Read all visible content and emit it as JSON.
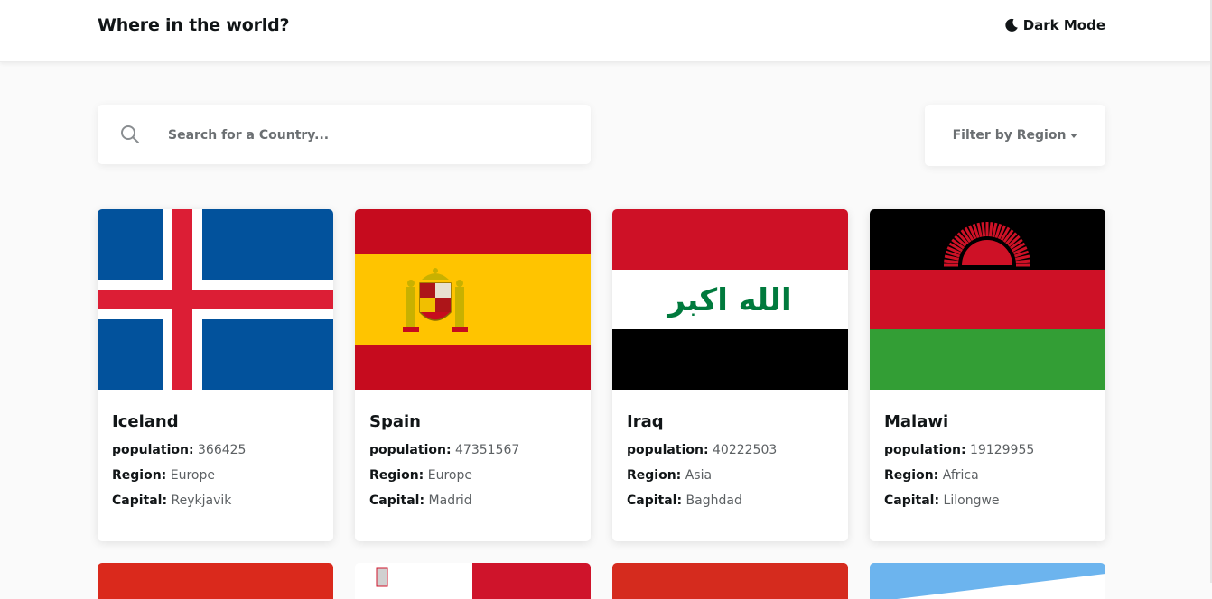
{
  "header": {
    "title": "Where in the world?",
    "dark_mode_label": "Dark Mode",
    "dark_mode_icon": "moon-icon"
  },
  "search": {
    "placeholder": "Search for a Country...",
    "value": "",
    "icon": "search-icon"
  },
  "filter": {
    "label": "Filter by Region",
    "icon": "caret-down-icon"
  },
  "labels": {
    "population": "population:",
    "region": "Region:",
    "capital": "Capital:"
  },
  "countries": [
    {
      "name": "Iceland",
      "population": "366425",
      "region": "Europe",
      "capital": "Reykjavik",
      "flag": "iceland-flag"
    },
    {
      "name": "Spain",
      "population": "47351567",
      "region": "Europe",
      "capital": "Madrid",
      "flag": "spain-flag"
    },
    {
      "name": "Iraq",
      "population": "40222503",
      "region": "Asia",
      "capital": "Baghdad",
      "flag": "iraq-flag",
      "flag_text": "الله اكبر"
    },
    {
      "name": "Malawi",
      "population": "19129955",
      "region": "Africa",
      "capital": "Lilongwe",
      "flag": "malawi-flag"
    }
  ],
  "colors": {
    "background": "#fafafa",
    "card": "#ffffff",
    "text": "#111517",
    "muted": "#6b6f72"
  }
}
